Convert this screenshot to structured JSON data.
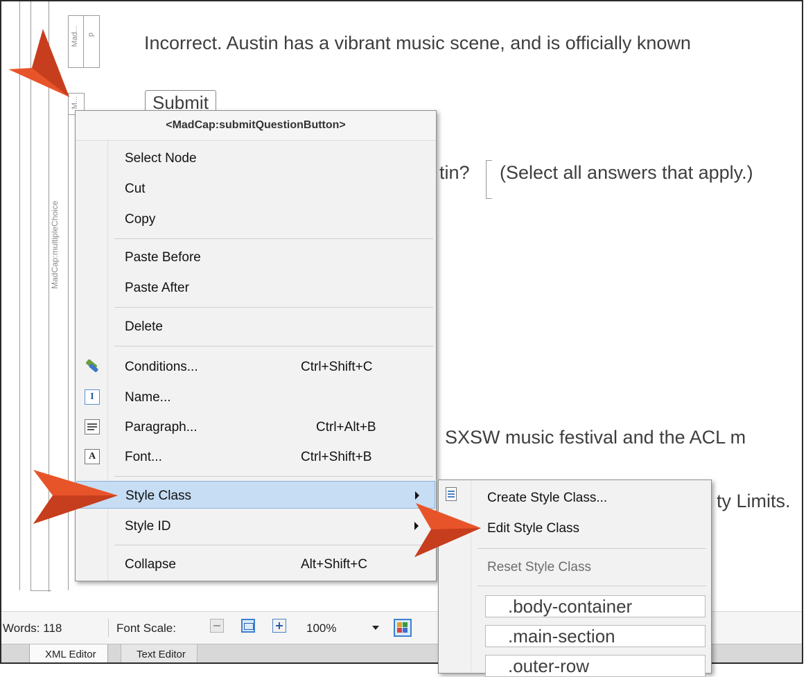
{
  "structure_bars": {
    "multiple_choice_label": "MadCap:multipleChoice",
    "p_label": "p",
    "mad_label_1": "Mad...",
    "mad_label_2": "M...",
    "mad_short": "Mad"
  },
  "document": {
    "line1": "Incorrect. Austin has a vibrant music scene, and is officially known",
    "submit_label": "Submit",
    "question_tail": "tin?",
    "select_hint": "(Select all answers that apply.)",
    "answer_line": "SXSW music festival and the ACL m",
    "answer_line2": "ty Limits."
  },
  "context_menu": {
    "header": "<MadCap:submitQuestionButton>",
    "items": [
      {
        "label": "Select Node",
        "shortcut": ""
      },
      {
        "label": "Cut",
        "shortcut": ""
      },
      {
        "label": "Copy",
        "shortcut": ""
      },
      {
        "label": "Paste Before",
        "shortcut": ""
      },
      {
        "label": "Paste After",
        "shortcut": ""
      },
      {
        "label": "Delete",
        "shortcut": ""
      },
      {
        "label": "Conditions...",
        "shortcut": "Ctrl+Shift+C",
        "icon": "conditions-tag-icon"
      },
      {
        "label": "Name...",
        "shortcut": "",
        "icon": "name-field-icon"
      },
      {
        "label": "Paragraph...",
        "shortcut": "Ctrl+Alt+B",
        "icon": "paragraph-icon"
      },
      {
        "label": "Font...",
        "shortcut": "Ctrl+Shift+B",
        "icon": "font-icon"
      },
      {
        "label": "Style Class",
        "shortcut": "",
        "submenu": true,
        "highlighted": true
      },
      {
        "label": "Style ID",
        "shortcut": "",
        "submenu": true
      },
      {
        "label": "Collapse",
        "shortcut": "Alt+Shift+C"
      }
    ]
  },
  "style_class_submenu": {
    "create": "Create Style Class...",
    "edit": "Edit Style Class",
    "reset": "Reset Style Class",
    "classes": [
      ".body-container",
      ".main-section",
      ".outer-row"
    ]
  },
  "status_bar": {
    "words": "Words: 118",
    "font_scale_label": "Font Scale:",
    "zoom": "100%"
  },
  "tabs": [
    {
      "label": "XML Editor",
      "active": true
    },
    {
      "label": "Text Editor",
      "active": false
    }
  ],
  "colors": {
    "accent_arrow": "#e8542a",
    "menu_highlight": "#c6ddf4"
  }
}
